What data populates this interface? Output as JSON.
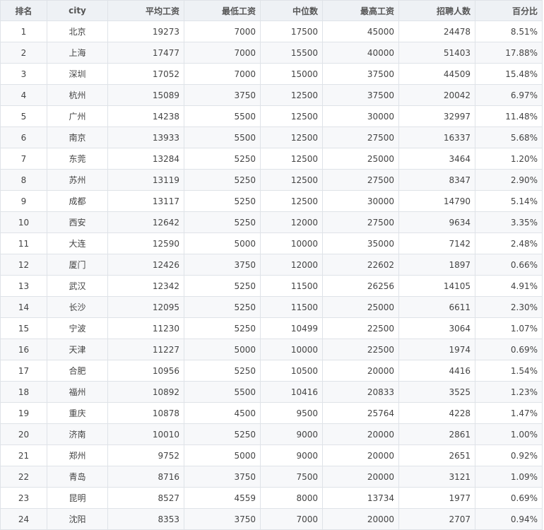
{
  "headers": [
    "排名",
    "city",
    "平均工资",
    "最低工资",
    "中位数",
    "最高工资",
    "招聘人数",
    "百分比"
  ],
  "rows": [
    [
      "1",
      "北京",
      "19273",
      "7000",
      "17500",
      "45000",
      "24478",
      "8.51%"
    ],
    [
      "2",
      "上海",
      "17477",
      "7000",
      "15500",
      "40000",
      "51403",
      "17.88%"
    ],
    [
      "3",
      "深圳",
      "17052",
      "7000",
      "15000",
      "37500",
      "44509",
      "15.48%"
    ],
    [
      "4",
      "杭州",
      "15089",
      "3750",
      "12500",
      "37500",
      "20042",
      "6.97%"
    ],
    [
      "5",
      "广州",
      "14238",
      "5500",
      "12500",
      "30000",
      "32997",
      "11.48%"
    ],
    [
      "6",
      "南京",
      "13933",
      "5500",
      "12500",
      "27500",
      "16337",
      "5.68%"
    ],
    [
      "7",
      "东莞",
      "13284",
      "5250",
      "12500",
      "25000",
      "3464",
      "1.20%"
    ],
    [
      "8",
      "苏州",
      "13119",
      "5250",
      "12500",
      "27500",
      "8347",
      "2.90%"
    ],
    [
      "9",
      "成都",
      "13117",
      "5250",
      "12500",
      "30000",
      "14790",
      "5.14%"
    ],
    [
      "10",
      "西安",
      "12642",
      "5250",
      "12000",
      "27500",
      "9634",
      "3.35%"
    ],
    [
      "11",
      "大连",
      "12590",
      "5000",
      "10000",
      "35000",
      "7142",
      "2.48%"
    ],
    [
      "12",
      "厦门",
      "12426",
      "3750",
      "12000",
      "22602",
      "1897",
      "0.66%"
    ],
    [
      "13",
      "武汉",
      "12342",
      "5250",
      "11500",
      "26256",
      "14105",
      "4.91%"
    ],
    [
      "14",
      "长沙",
      "12095",
      "5250",
      "11500",
      "25000",
      "6611",
      "2.30%"
    ],
    [
      "15",
      "宁波",
      "11230",
      "5250",
      "10499",
      "22500",
      "3064",
      "1.07%"
    ],
    [
      "16",
      "天津",
      "11227",
      "5000",
      "10000",
      "22500",
      "1974",
      "0.69%"
    ],
    [
      "17",
      "合肥",
      "10956",
      "5250",
      "10500",
      "20000",
      "4416",
      "1.54%"
    ],
    [
      "18",
      "福州",
      "10892",
      "5500",
      "10416",
      "20833",
      "3525",
      "1.23%"
    ],
    [
      "19",
      "重庆",
      "10878",
      "4500",
      "9500",
      "25764",
      "4228",
      "1.47%"
    ],
    [
      "20",
      "济南",
      "10010",
      "5250",
      "9000",
      "20000",
      "2861",
      "1.00%"
    ],
    [
      "21",
      "郑州",
      "9752",
      "5000",
      "9000",
      "20000",
      "2651",
      "0.92%"
    ],
    [
      "22",
      "青岛",
      "8716",
      "3750",
      "7500",
      "20000",
      "3121",
      "1.09%"
    ],
    [
      "23",
      "昆明",
      "8527",
      "4559",
      "8000",
      "13734",
      "1977",
      "0.69%"
    ],
    [
      "24",
      "沈阳",
      "8353",
      "3750",
      "7000",
      "20000",
      "2707",
      "0.94%"
    ]
  ]
}
